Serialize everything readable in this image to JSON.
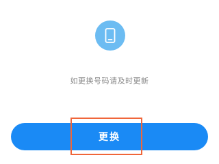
{
  "icon": {
    "name": "phone-icon",
    "badge_color": "#6cbcf2"
  },
  "hint": {
    "text": "如更换号码请及时更新"
  },
  "action": {
    "button_label": "更换",
    "button_color": "#1a8af5",
    "highlight_color": "#f0663a"
  }
}
